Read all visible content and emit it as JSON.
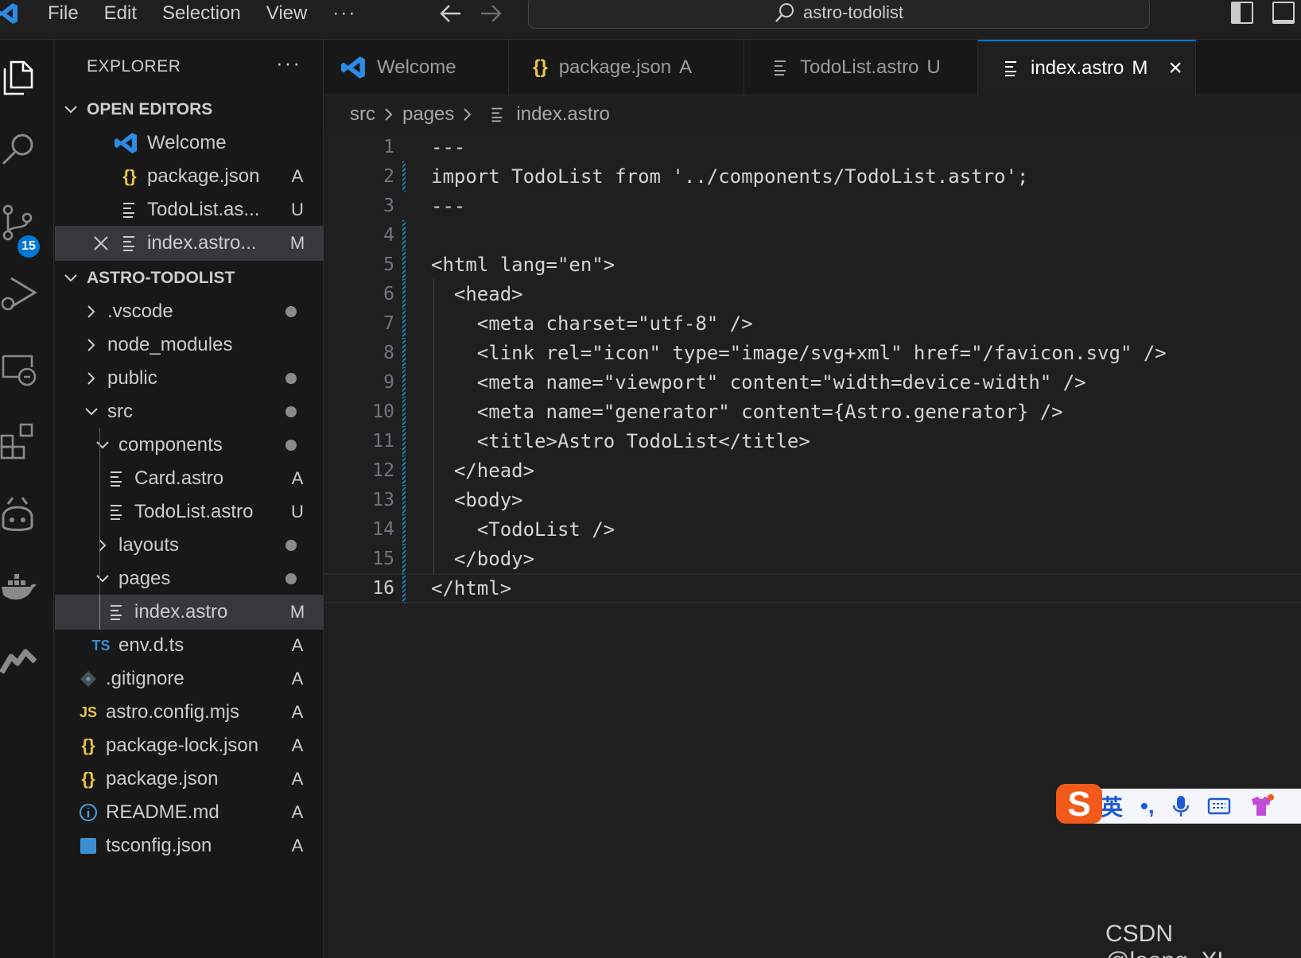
{
  "menu": {
    "items": [
      "File",
      "Edit",
      "Selection",
      "View"
    ],
    "more": "···"
  },
  "command_center": {
    "text": "astro-todolist"
  },
  "activity_bar": {
    "source_control_badge": "15"
  },
  "sidebar": {
    "title": "EXPLORER",
    "more": "···",
    "open_editors_label": "OPEN EDITORS",
    "open_editors": [
      {
        "name": "Welcome",
        "status": ""
      },
      {
        "name": "package.json",
        "status": "A"
      },
      {
        "name": "TodoList.as...",
        "status": "U"
      },
      {
        "name": "index.astro...",
        "status": "M"
      }
    ],
    "project_label": "ASTRO-TODOLIST",
    "tree": [
      {
        "name": ".vscode",
        "status": ""
      },
      {
        "name": "node_modules",
        "status": ""
      },
      {
        "name": "public",
        "status": ""
      },
      {
        "name": "src",
        "status": ""
      },
      {
        "name": "components",
        "status": ""
      },
      {
        "name": "Card.astro",
        "status": "A"
      },
      {
        "name": "TodoList.astro",
        "status": "U"
      },
      {
        "name": "layouts",
        "status": ""
      },
      {
        "name": "pages",
        "status": ""
      },
      {
        "name": "index.astro",
        "status": "M"
      },
      {
        "name": "env.d.ts",
        "status": "A"
      },
      {
        "name": ".gitignore",
        "status": "A"
      },
      {
        "name": "astro.config.mjs",
        "status": "A"
      },
      {
        "name": "package-lock.json",
        "status": "A"
      },
      {
        "name": "package.json",
        "status": "A"
      },
      {
        "name": "README.md",
        "status": "A"
      },
      {
        "name": "tsconfig.json",
        "status": "A"
      }
    ],
    "file_icons": {
      "ts": "TS",
      "js": "JS",
      "json": "{}"
    }
  },
  "tabs": [
    {
      "label": "Welcome",
      "status": ""
    },
    {
      "label": "package.json",
      "status": "A"
    },
    {
      "label": "TodoList.astro",
      "status": "U"
    },
    {
      "label": "index.astro",
      "status": "M"
    }
  ],
  "breadcrumb": [
    "src",
    "pages",
    "index.astro"
  ],
  "editor": {
    "line_numbers": [
      "1",
      "2",
      "3",
      "4",
      "5",
      "6",
      "7",
      "8",
      "9",
      "10",
      "11",
      "12",
      "13",
      "14",
      "15",
      "16"
    ],
    "lines": [
      "---",
      "import TodoList from '../components/TodoList.astro';",
      "---",
      "",
      "<html lang=\"en\">",
      "  <head>",
      "    <meta charset=\"utf-8\" />",
      "    <link rel=\"icon\" type=\"image/svg+xml\" href=\"/favicon.svg\" />",
      "    <meta name=\"viewport\" content=\"width=device-width\" />",
      "    <meta name=\"generator\" content={Astro.generator} />",
      "    <title>Astro TodoList</title>",
      "  </head>",
      "  <body>",
      "    <TodoList />",
      "  </body>",
      "</html>"
    ]
  },
  "ime": {
    "lang": "英",
    "punct": "•,",
    "logo": "S"
  },
  "watermark": "CSDN @loong_XL",
  "colors": {
    "accent": "#0078d4",
    "vscode_blue": "#2b8ce6",
    "json_yellow": "#e8c548",
    "ts_blue": "#3d8fd1",
    "git_marker": "#1b81a8",
    "ime_orange": "#f25a1a"
  }
}
